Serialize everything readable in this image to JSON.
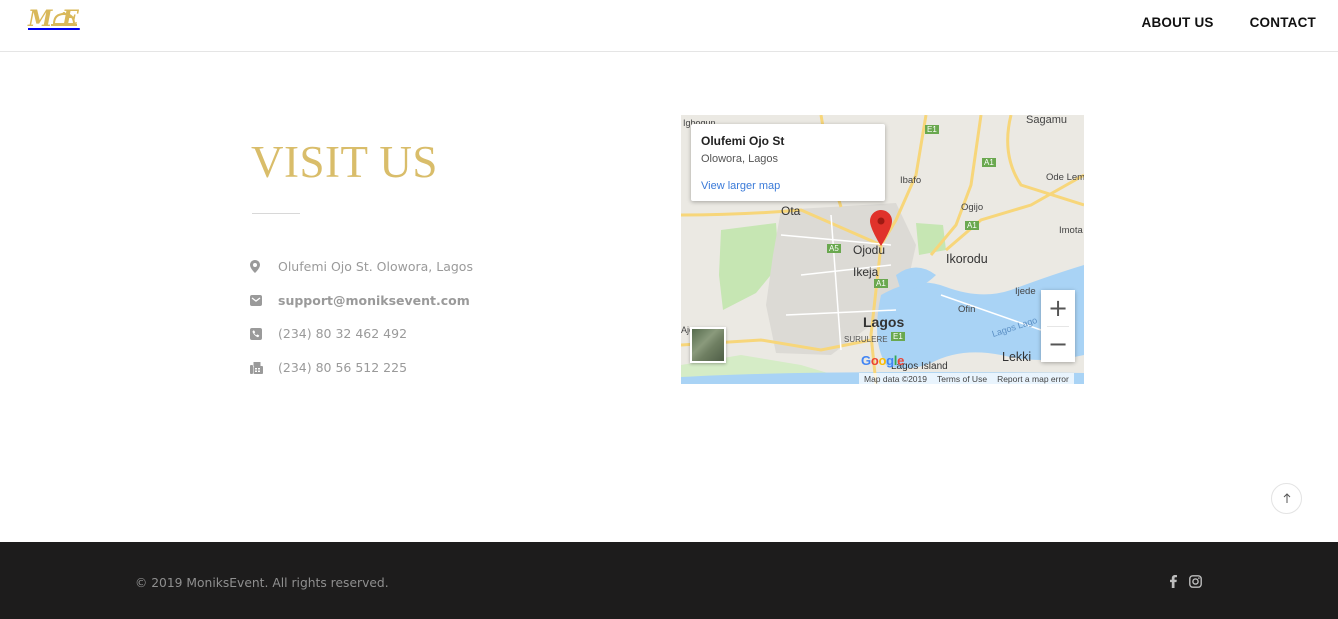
{
  "header": {
    "logo_text": "M E",
    "nav": [
      {
        "label": "ABOUT US"
      },
      {
        "label": "CONTACT"
      }
    ]
  },
  "visit": {
    "title": "VISIT US",
    "address": "Olufemi Ojo St. Olowora, Lagos",
    "email": "support@moniksevent.com",
    "phone": "(234) 80 32 462 492",
    "fax": "(234) 80 56 512 225",
    "icons": [
      "map-marker-icon",
      "envelope-icon",
      "phone-icon",
      "fax-icon"
    ]
  },
  "map": {
    "info_title": "Olufemi Ojo St",
    "info_sub": "Olowora, Lagos",
    "info_link": "View larger map",
    "zoom_in": "+",
    "zoom_out": "−",
    "labels": {
      "igbogun": "Igbogun",
      "sagamu": "Sagamu",
      "e1_a": "E1",
      "a1_a": "A1",
      "ibafo": "Ibafo",
      "ode_lemo": "Ode Lem",
      "ogijo": "Ogijo",
      "a1_b": "A1",
      "imota": "Imota",
      "ota": "Ota",
      "ojodu": "Ojodu",
      "ikorodu": "Ikorodu",
      "a5": "A5",
      "ikeja": "Ikeja",
      "a1_c": "A1",
      "ijede": "Ijede",
      "lagos": "Lagos",
      "ofin": "Ofin",
      "lagos_lagoon": "Lagos Lago",
      "e1_b": "E1",
      "surulere": "SURULERE",
      "lekki": "Lekki",
      "lagos_island": "Lagos Island",
      "ajo": "Ajo"
    },
    "footer_items": [
      "Map data ©2019",
      "Terms of Use",
      "Report a map error"
    ],
    "google": [
      "G",
      "o",
      "o",
      "g",
      "l",
      "e"
    ],
    "colors": {
      "water": "#a9d3f5",
      "road": "#f7d67a",
      "park": "#c6e6b3",
      "pin": "#e0322b"
    }
  },
  "footer": {
    "copyright": "© 2019 MoniksEvent. All rights reserved.",
    "social": [
      "facebook-icon",
      "instagram-icon"
    ]
  },
  "colors": {
    "gold": "#d9bd6a",
    "footer_bg": "#1d1c1c"
  }
}
